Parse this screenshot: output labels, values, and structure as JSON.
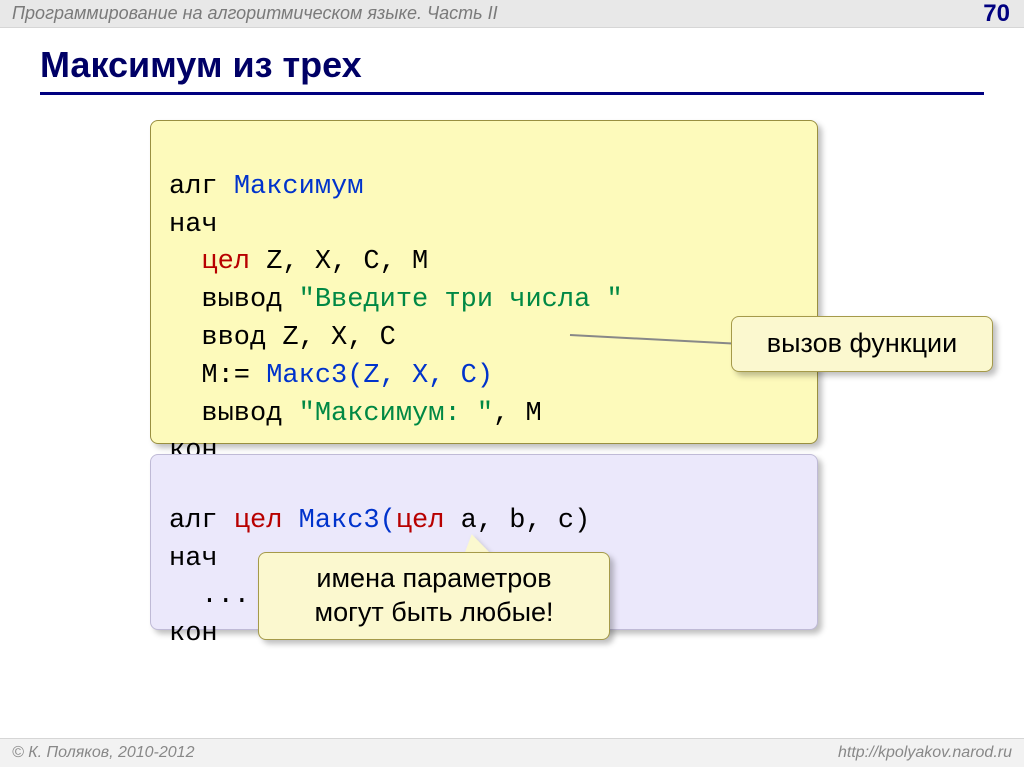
{
  "header": {
    "lecture": "Программирование на алгоритмическом языке. Часть II",
    "page": "70"
  },
  "title": "Максимум из трех",
  "code1": {
    "l1_a": "алг ",
    "l1_b": "Максимум",
    "l2": "нач",
    "l3_a": "  ",
    "l3_b": "цел",
    "l3_c": " Z, X, C, M",
    "l4_a": "  вывод ",
    "l4_b": "\"Введите три числа \"",
    "l5": "  ввод Z, X, C",
    "l6_a": "  M:= ",
    "l6_b": "Макс3(Z, X, C)",
    "l7_a": "  вывод ",
    "l7_b": "\"Максимум: \"",
    "l7_c": ", M",
    "l8": "кон"
  },
  "code2": {
    "l1_a": "алг ",
    "l1_b": "цел ",
    "l1_c": "Макс3(",
    "l1_d": "цел",
    "l1_e": " a, b, c)",
    "l2": "нач",
    "l3": "  ...",
    "l4": "кон"
  },
  "callout1": "вызов функции",
  "callout2_l1": "имена параметров",
  "callout2_l2": "могут быть любые!",
  "footer": {
    "copyright": "© К. Поляков, 2010-2012",
    "url": "http://kpolyakov.narod.ru"
  }
}
